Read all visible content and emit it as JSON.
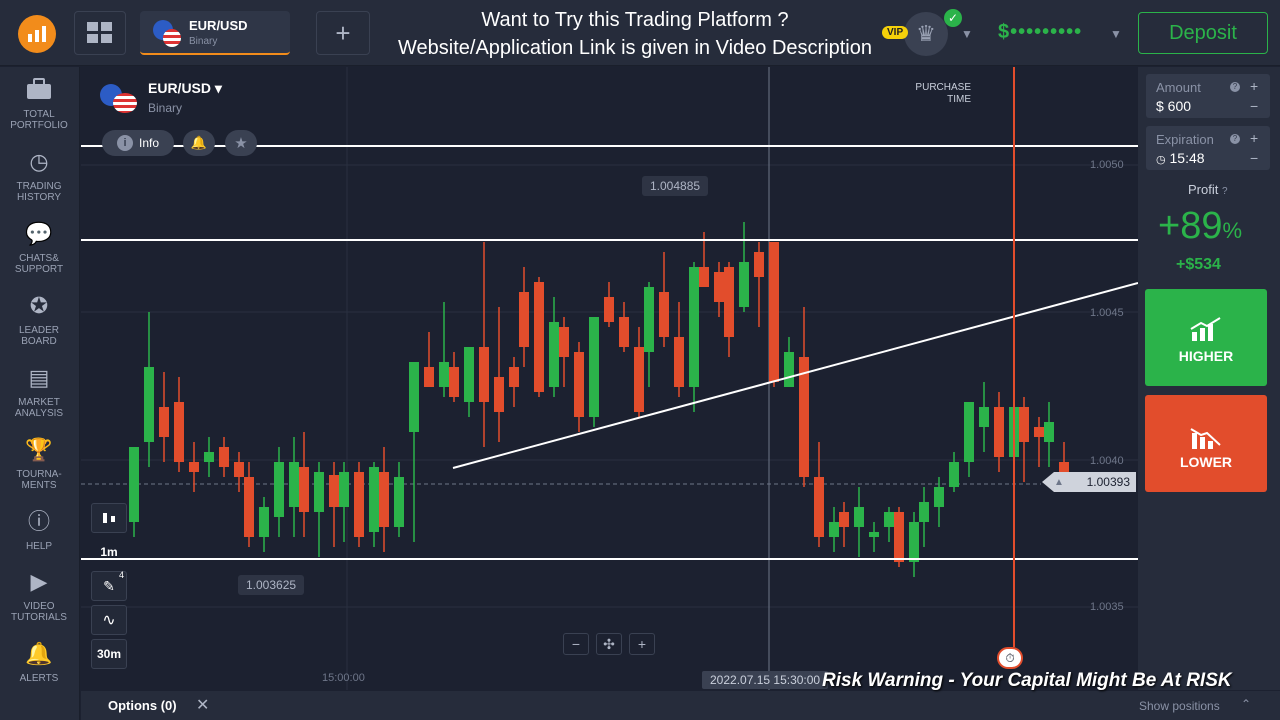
{
  "topbar": {
    "asset": {
      "name": "EUR/USD",
      "type": "Binary"
    },
    "promo_line1": "Want to Try this Trading Platform ?",
    "promo_line2": "Website/Application Link is given in Video Description",
    "vip_label": "VIP",
    "balance": "$•••••••••",
    "deposit_label": "Deposit",
    "add_tab": "+"
  },
  "sidebar": {
    "items": [
      {
        "label": "TOTAL PORTFOLIO",
        "icon": "briefcase-icon"
      },
      {
        "label": "TRADING HISTORY",
        "icon": "history-icon"
      },
      {
        "label": "CHATS& SUPPORT",
        "icon": "chat-icon"
      },
      {
        "label": "LEADER BOARD",
        "icon": "leaderboard-icon"
      },
      {
        "label": "MARKET ANALYSIS",
        "icon": "news-icon"
      },
      {
        "label": "TOURNA- MENTS",
        "icon": "trophy-icon"
      },
      {
        "label": "HELP",
        "icon": "help-icon"
      },
      {
        "label": "VIDEO TUTORIALS",
        "icon": "play-icon"
      },
      {
        "label": "ALERTS",
        "icon": "bell-icon"
      }
    ]
  },
  "chart": {
    "asset": "EUR/USD",
    "asset_type": "Binary",
    "info_label": "Info",
    "purchase_time_line1": "PURCHASE",
    "purchase_time_line2": "TIME",
    "high_label": "1.004885",
    "low_label": "1.003625",
    "current_price": "1.00393",
    "y_ticks": [
      "1.0050",
      "1.0045",
      "1.0040",
      "1.0035"
    ],
    "time_label": "15:00:00",
    "cursor_time": "2022.07.15 15:30:00",
    "timeframe": "1m",
    "interval": "30m",
    "drawing_count": "4",
    "zoom_out": "−",
    "zoom_center": "✣",
    "zoom_in": "+"
  },
  "trade": {
    "amount_label": "Amount",
    "amount_value": "$ 600",
    "expiration_label": "Expiration",
    "expiration_value": "15:48",
    "profit_label": "Profit",
    "profit_percent": "+89",
    "percent_sign": "%",
    "profit_amount": "+$534",
    "higher_label": "HIGHER",
    "lower_label": "LOWER"
  },
  "bottom": {
    "options_label": "Options (0)",
    "show_positions": "Show positions"
  },
  "overlay": {
    "risk_warning": "Risk Warning - Your Capital Might Be At RISK"
  },
  "colors": {
    "green": "#2bb34a",
    "red": "#e24d2c",
    "orange": "#f28c1b",
    "background": "#1c2130"
  }
}
